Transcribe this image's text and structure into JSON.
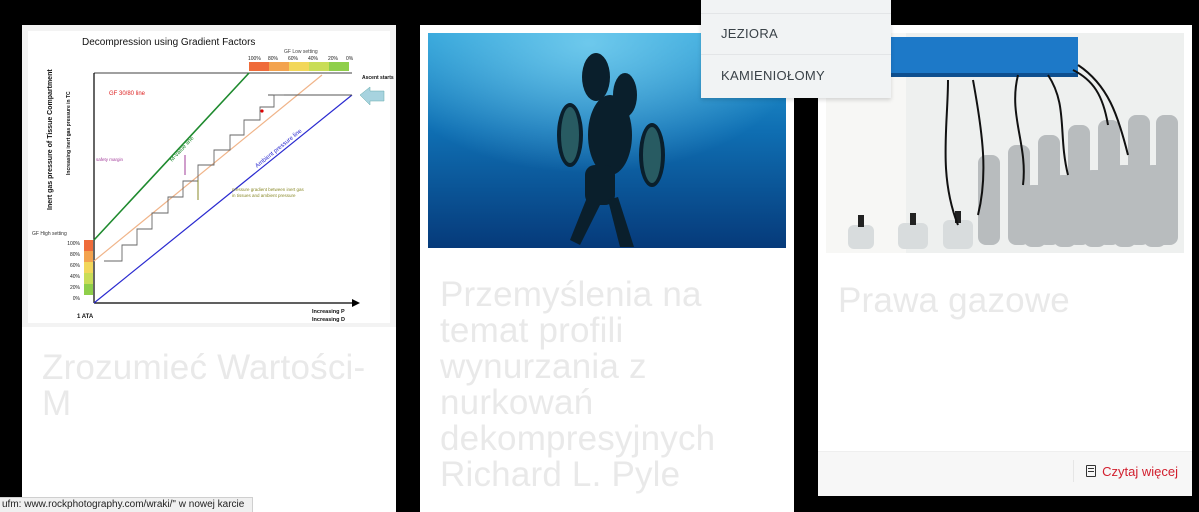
{
  "dropdown": {
    "items": [
      {
        "label": "JEZIORA"
      },
      {
        "label": "KAMIENIOŁOMY"
      }
    ]
  },
  "cards": [
    {
      "title": "Zrozumieć Wartości-M",
      "image": {
        "title": "Decompression using Gradient Factors",
        "gf_low_setting": "GF Low setting",
        "gf_high_setting": "GF High setting",
        "top_percents": [
          "100%",
          "80%",
          "60%",
          "40%",
          "20%",
          "0%"
        ],
        "left_percents": [
          "100%",
          "80%",
          "60%",
          "40%",
          "20%",
          "0%"
        ],
        "gf_line": "GF 30/80 line",
        "m_value_line": "M-value line",
        "ambient_line": "Ambient pressure line",
        "safety_margin": "safety margin",
        "pressure_gradient": "pressure gradient between inert gas in tissues and ambient pressure",
        "ascent_starts": "Ascent starts",
        "y_label": "Inert gas pressure of Tissue Compartment",
        "y_label_2": "Increasing inert gas pressure in TC",
        "x_label": "Increasing P",
        "x_label_2": "Increasing D",
        "ata": "1 ATA"
      }
    },
    {
      "title": "Przemyślenia na temat profili wynurzania z nurkowań dekompresyjnych Richard L. Pyle"
    },
    {
      "title": "Prawa gazowe",
      "read_more": "Czytaj więcej"
    }
  ],
  "status_bar": {
    "text": "ufm: www.rockphotography.com/wraki/\" w nowej karcie"
  }
}
